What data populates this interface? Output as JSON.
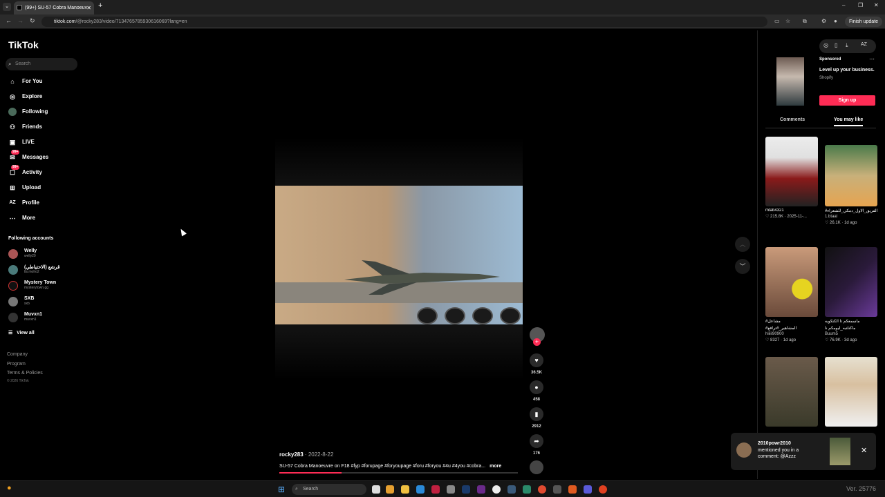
{
  "browser": {
    "tab_title": "(99+) SU-57 Cobra Manoeuv",
    "new_tab": "+",
    "url_host": "tiktok.com",
    "url_path": "/@rocky283/video/7134765785930616069?lang=en",
    "finish_update": "Finish update",
    "window_controls": [
      "–",
      "❐",
      "✕"
    ]
  },
  "sidebar": {
    "logo": "TikTok",
    "search_placeholder": "Search",
    "nav": [
      {
        "label": "For You",
        "icon": "home-icon"
      },
      {
        "label": "Explore",
        "icon": "compass-icon"
      },
      {
        "label": "Following",
        "icon": "following-icon"
      },
      {
        "label": "Friends",
        "icon": "friends-icon"
      },
      {
        "label": "LIVE",
        "icon": "live-icon"
      },
      {
        "label": "Messages",
        "icon": "messages-icon",
        "badge": "99+"
      },
      {
        "label": "Activity",
        "icon": "activity-icon",
        "badge": "99+"
      },
      {
        "label": "Upload",
        "icon": "upload-icon"
      },
      {
        "label": "Profile",
        "icon": "profile-icon"
      },
      {
        "label": "More",
        "icon": "more-icon"
      }
    ],
    "following_title": "Following accounts",
    "accounts": [
      {
        "name": "Welly",
        "handle": "welly20"
      },
      {
        "name": "قرشع (الاحتياطي)",
        "handle": "lts.moho2"
      },
      {
        "name": "Mystery Town",
        "handle": "mysterytown.gg"
      },
      {
        "name": "SXB",
        "handle": "sxb"
      },
      {
        "name": "Muvxn1",
        "handle": "muvxn1"
      }
    ],
    "view_all": "View all",
    "footer_links": [
      "Company",
      "Program",
      "Terms & Policies"
    ],
    "copyright": "© 2026 TikTok"
  },
  "video": {
    "author": "rocky283",
    "date": " · 2022-8-22",
    "caption": "SU-57 Cobra Manoeuvre on F18 #fyp #forupage #foryoupage #foru #foryou #4u #4you #cobra...",
    "more": "more",
    "progress": 0.26
  },
  "actions": {
    "likes": "36.5K",
    "comments": "458",
    "saves": "2912",
    "shares": "176"
  },
  "right_panel": {
    "sponsored": "Sponsored",
    "ad_title": "Level up your business.",
    "ad_brand": "Shopify",
    "signup": "Sign up",
    "tab_comments": "Comments",
    "tab_you_may_like": "You may like",
    "cards": [
      {
        "caption": "mtab4321",
        "meta": "♡ 215.8K · 2025-11-...",
        "color": "#7a2a2a"
      },
      {
        "caption": "#الفريق_الاول_دمكي_للشعراء",
        "meta": "1.btaal",
        "meta2": "♡ 26.1K · 1d ago",
        "color": "#7a6a3a"
      },
      {
        "caption": "#مشاعل",
        "meta": "#المشاهير_#ترافع",
        "meta2": "hiiiii90900",
        "meta3": "♡ 8327 · 1d ago",
        "color": "#8a6a5a"
      },
      {
        "caption": "ماسمعكم تا الكتكويه",
        "meta": "ماكنلتبه_ليومكم نا",
        "meta2": "Buum5",
        "meta3": "♡ 76.9K · 3d ago",
        "color": "#3a2a4a"
      },
      {
        "caption": "",
        "meta": "",
        "color": "#6a5a4a"
      },
      {
        "caption": "",
        "meta": "",
        "color": "#d8cfc0"
      }
    ]
  },
  "notification": {
    "user": "2010powr2010",
    "line2": "mentioned you in a",
    "line3": "comment: @Azzz"
  },
  "taskbar": {
    "search_placeholder": "Search",
    "version": "Ver. 25776"
  }
}
